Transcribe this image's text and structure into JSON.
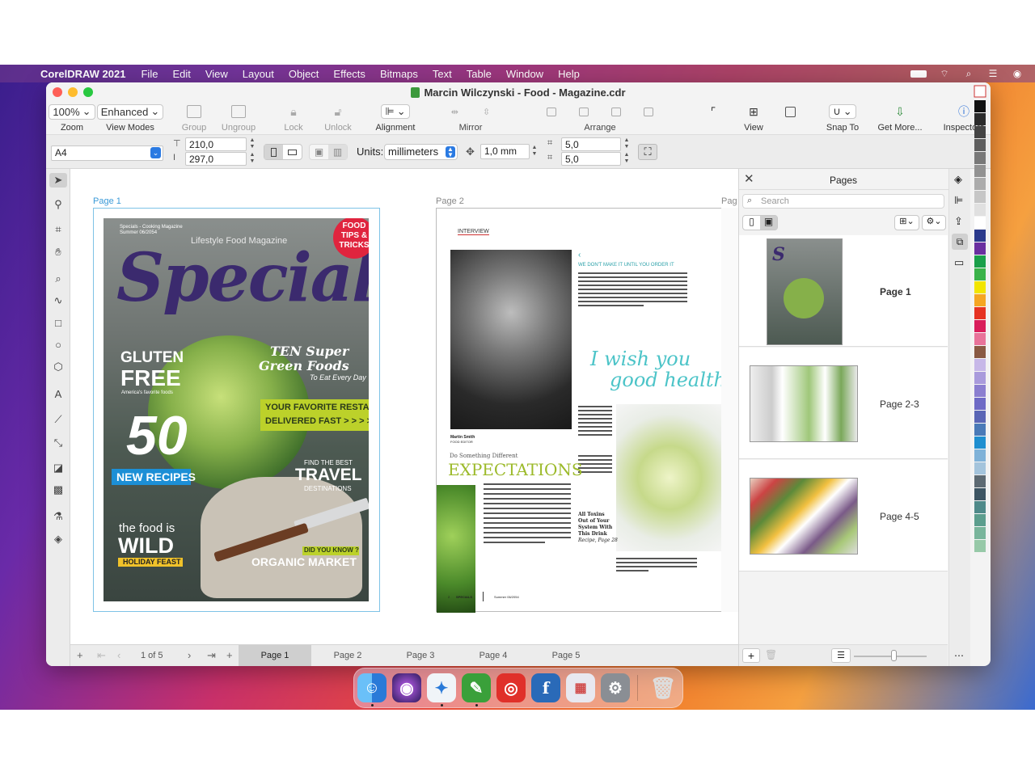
{
  "menubar": {
    "app_name": "CorelDRAW 2021",
    "items": [
      "File",
      "Edit",
      "View",
      "Layout",
      "Object",
      "Effects",
      "Bitmaps",
      "Text",
      "Table",
      "Window",
      "Help"
    ]
  },
  "window": {
    "title": "Marcin Wilczynski - Food - Magazine.cdr"
  },
  "toolbar": {
    "zoom_value": "100%",
    "zoom_label": "Zoom",
    "viewmode_value": "Enhanced",
    "viewmode_label": "View Modes",
    "group": "Group",
    "ungroup": "Ungroup",
    "lock": "Lock",
    "unlock": "Unlock",
    "alignment": "Alignment",
    "mirror": "Mirror",
    "arrange": "Arrange",
    "view": "View",
    "snap_to": "Snap To",
    "get_more": "Get More...",
    "inspectors": "Inspectors"
  },
  "propbar": {
    "page_size": "A4",
    "width": "210,0",
    "height": "297,0",
    "units_label": "Units:",
    "units_value": "millimeters",
    "nudge": "1,0 mm",
    "dup_x": "5,0",
    "dup_y": "5,0"
  },
  "canvas": {
    "page1_label": "Page 1",
    "page2_label": "Page 2",
    "page3_label": "Pag",
    "cover": {
      "topline": "Specials - Cooking Magazine",
      "issue": "Summer 06/2054",
      "subtitle": "Lifestyle Food Magazine",
      "masthead": "Specials",
      "badge": [
        "FOOD",
        "TIPS &",
        "TRICKS"
      ],
      "gluten1": "GLUTEN",
      "gluten2": "FREE",
      "gluten3": "America's favorite foods",
      "ten1": "TEN Super",
      "ten2": "Green Foods",
      "ten3": "To Eat Every Day",
      "restaurants1": "YOUR FAVORITE RESTAURANTS,",
      "restaurants2": "DELIVERED FAST > > > >",
      "fifty": "50",
      "new_recipes": "NEW RECIPES",
      "find": "FIND THE BEST",
      "travel": "TRAVEL",
      "destinations": "DESTINATIONS",
      "food_is": "the food is",
      "wild": "WILD",
      "holiday": "HOLIDAY FEAST",
      "did_you_know": "DID YOU KNOW ?",
      "organic": "ORGANIC MARKET"
    },
    "spread": {
      "interview": "INTERVIEW",
      "we_dont": "WE DON'T MAKE IT UNTIL YOU ORDER IT",
      "wish1": "I wish you",
      "wish2": "good health.",
      "caption_name": "Martin Smith",
      "caption_role": "FOOD EDITOR",
      "do_something": "Do Something Different",
      "expectations": "EXPECTATIONS",
      "toxins": [
        "All Toxins",
        "Out of Your",
        "System With",
        "This Drink"
      ],
      "recipe": "Recipe, Page 28",
      "footer_page": "2",
      "footer_mag": "SPECIALS",
      "footer_issue": "Summer 06/2054"
    }
  },
  "pagebar": {
    "counter": "1 of 5",
    "tabs": [
      "Page 1",
      "Page 2",
      "Page 3",
      "Page 4",
      "Page 5"
    ]
  },
  "docker": {
    "title": "Pages",
    "search_placeholder": "Search",
    "pages": [
      "Page 1",
      "Page 2-3",
      "Page 4-5"
    ]
  },
  "palette_colors": [
    "#111111",
    "#2b2b2b",
    "#444444",
    "#5e5e5e",
    "#787878",
    "#929292",
    "#acacac",
    "#c6c6c6",
    "#e0e0e0",
    "#ffffff",
    "#2b3a8c",
    "#6a2fa0",
    "#1a9f4a",
    "#3bb34a",
    "#f2e500",
    "#f5a623",
    "#e63323",
    "#d91e5b",
    "#e8739a",
    "#8a5a44",
    "#c7b8e8",
    "#a99bdc",
    "#8b7fd0",
    "#6f6bc6",
    "#5a66b6",
    "#4a7ab8",
    "#1f8fd0",
    "#7fb2d8",
    "#a4c4dc",
    "#5d6a73",
    "#3e5664",
    "#4f8a8a",
    "#5c9e8e",
    "#79b59c",
    "#97c9a8"
  ],
  "dock_apps": [
    "finder-icon",
    "siri-icon",
    "safari-icon",
    "coreldraw-icon",
    "photo-booth-icon",
    "font-app-icon",
    "launchpad-icon",
    "system-preferences-icon",
    "trash-icon"
  ]
}
